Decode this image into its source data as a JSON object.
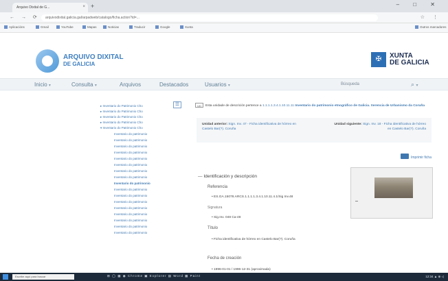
{
  "browser": {
    "tab_title": "Arquivo Dixital de G...",
    "tab_close": "×",
    "tab_new": "+",
    "window_controls": "– □ ✕",
    "nav_buttons": "← → ⟳",
    "url": "arquivodixital.galicia.gal/arpadweb/catalogo/ficha.action?id=...",
    "address_icons": "☆ ⋮",
    "bookmarks": [
      "Aplicacións",
      "Gmail",
      "YouTube",
      "Mapas",
      "Noticias",
      "Traducir",
      "Google",
      "Xunta",
      "Outros marcadores"
    ]
  },
  "site": {
    "logo_line1": "ARQUIVO DIXITAL",
    "logo_line2": "DE GALICIA",
    "xunta_line1": "XUNTA",
    "xunta_line2": "DE GALICIA"
  },
  "nav": {
    "items": [
      {
        "label": "Inicio"
      },
      {
        "label": "Consulta"
      },
      {
        "label": "Arquivos"
      },
      {
        "label": "Destacados"
      },
      {
        "label": "Usuarios"
      }
    ],
    "search_label": "Búsqueda"
  },
  "tree": {
    "toggle": "☰",
    "parents": [
      "Inventario do Patrimonio Cho",
      "Inventario do Patrimonio Cho",
      "Inventario do Patrimonio Cho",
      "Inventario do Patrimonio Cho",
      "Inventario do Patrimonio Cho"
    ],
    "children": [
      "Inventario do patrimonio",
      "Inventario do patrimonio",
      "Inventario do patrimonio",
      "Inventario do patrimonio",
      "Inventario do patrimonio",
      "Inventario do patrimonio",
      "Inventario do patrimonio",
      "Inventario do patrimonio",
      "Inventario do patrimonio",
      "Inventario do patrimonio",
      "Inventario do patrimonio",
      "Inventario do patrimonio",
      "Inventario do patrimonio",
      "Inventario do patrimonio",
      "Inventario do patrimonio",
      "Inventario do patrimonio",
      "Inventario do patrimonio"
    ]
  },
  "main": {
    "parent_badge": "UD",
    "parent_prefix": "Esta unidade de descrición pertence a",
    "parent_code": "1.1.1.1.3.4.1.10.11.11",
    "parent_title": "Inventario do patrimonio etnográfico de Galicia. Xerencia de Urbanismo da Coruña",
    "prev_label": "Unidad anterior:",
    "prev_value": "Sign. Inv. 47 - Ficha identificativa de hórreo en Castelo Bar(?). Coruña",
    "next_label": "Unidad siguiente:",
    "next_value": "Sign. Inv. 18 - Ficha identificativa de hórreo en Castelo Bar(?). Coruña",
    "print_label": "Imprimir ficha",
    "section_title": "Identificación y descripción",
    "reference_label": "Referencia",
    "reference_value": "ES.GA.15078.ARCS.1.1.1.1.3.4.1.10.11.4.1/Sig Inv.48",
    "signatura_label": "Signatura",
    "signatura_value": "Sig.Inv. 048 Ca-48",
    "title_label": "Título",
    "title_value": "Ficha identificativa de hórreo en Castelo Bar(?). Coruña",
    "date_label": "Fecha de creación",
    "date_value": "1996-01-01 / 1996-12-31 (aproximada)"
  },
  "taskbar": {
    "search_placeholder": "Escribe aquí para buscar",
    "apps": "⊞  ◯  ▦  ◉  Chrome  ▣  Explorer  ▤  Word  ▦  Paint",
    "clock": "12:34  ▲ ⊕ ◁"
  }
}
